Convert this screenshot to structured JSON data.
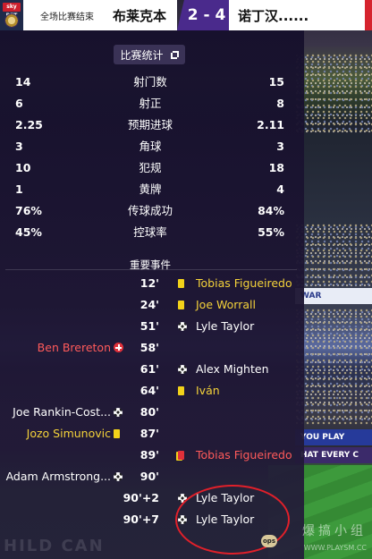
{
  "header": {
    "broadcaster": "sky BET",
    "status": "全场比赛结束",
    "home_team": "布莱克本",
    "score": "2 - 4",
    "away_team": "诺丁汉......"
  },
  "stats_title": "比赛统计",
  "stats": [
    {
      "home": "14",
      "label": "射门数",
      "away": "15"
    },
    {
      "home": "6",
      "label": "射正",
      "away": "8"
    },
    {
      "home": "2.25",
      "label": "预期进球",
      "away": "2.11"
    },
    {
      "home": "3",
      "label": "角球",
      "away": "3"
    },
    {
      "home": "10",
      "label": "犯规",
      "away": "18"
    },
    {
      "home": "1",
      "label": "黄牌",
      "away": "4"
    },
    {
      "home": "76%",
      "label": "传球成功",
      "away": "84%"
    },
    {
      "home": "45%",
      "label": "控球率",
      "away": "55%"
    }
  ],
  "events_title": "重要事件",
  "events": [
    {
      "minute": "12'",
      "side": "away",
      "type": "yellow-card",
      "player": "Tobias Figueiredo",
      "color": "yellow"
    },
    {
      "minute": "24'",
      "side": "away",
      "type": "yellow-card",
      "player": "Joe Worrall",
      "color": "yellow"
    },
    {
      "minute": "51'",
      "side": "away",
      "type": "goal",
      "player": "Lyle Taylor",
      "color": "white"
    },
    {
      "minute": "58'",
      "side": "home",
      "type": "sub",
      "player": "Ben Brereton",
      "color": "red"
    },
    {
      "minute": "61'",
      "side": "away",
      "type": "goal",
      "player": "Alex Mighten",
      "color": "white"
    },
    {
      "minute": "64'",
      "side": "away",
      "type": "yellow-card",
      "player": "Iván",
      "color": "yellow"
    },
    {
      "minute": "80'",
      "side": "home",
      "type": "goal",
      "player": "Joe Rankin-Cost...",
      "color": "white"
    },
    {
      "minute": "87'",
      "side": "home",
      "type": "yellow-card",
      "player": "Jozo Simunovic",
      "color": "yellow"
    },
    {
      "minute": "89'",
      "side": "away",
      "type": "red-card",
      "player": "Tobias Figueiredo",
      "color": "red"
    },
    {
      "minute": "90'",
      "side": "home",
      "type": "goal",
      "player": "Adam Armstrong...",
      "color": "white"
    },
    {
      "minute": "90'+2",
      "side": "away",
      "type": "goal",
      "player": "Lyle Taylor",
      "color": "white"
    },
    {
      "minute": "90'+7",
      "side": "away",
      "type": "goal",
      "player": "Lyle Taylor",
      "color": "white"
    }
  ],
  "background": {
    "adboard_1": "WAR",
    "adboard_2": "YOU PLAY",
    "adboard_3": "HAT EVERY C",
    "bottom_text": "HILD CAN",
    "ops": "ops"
  },
  "watermark": {
    "text": "爆搞小组",
    "url": "WWW.PLAYSM.CC"
  },
  "colors": {
    "panel": "#1e1634",
    "score_bg": "#4a2a8c",
    "highlight_yellow": "#f4d23a",
    "highlight_red": "#ff5a5a",
    "annotation": "#e0202a"
  }
}
